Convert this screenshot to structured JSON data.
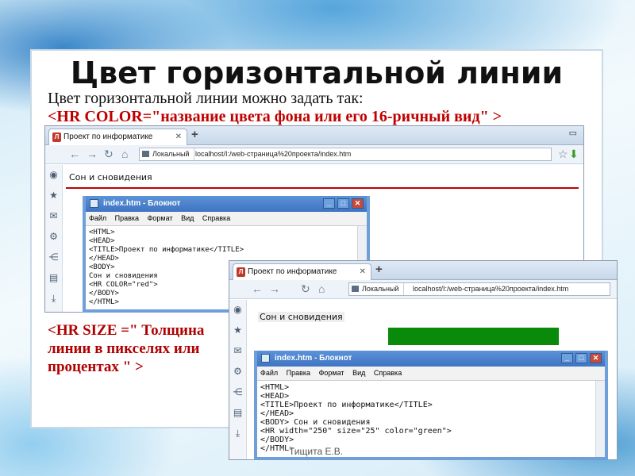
{
  "slide": {
    "title": "Цвет горизонтальной линии",
    "intro": "Цвет горизонтальной линии можно задать так:",
    "code": "<HR COLOR=\"название цвета фона или его 16-ричный вид\" >",
    "size_text": "<HR SIZE =\" Толщина линии в пикселях или процентах \" >",
    "author": "Тищита Е.В."
  },
  "browser1": {
    "tab_title": "Проект по информатике",
    "new_tab": "+",
    "local_label": "Локальный",
    "url": "localhost/I:/web-страница%20проекта/index.htm",
    "page_text": "Сон и сновидения"
  },
  "browser2": {
    "tab_title": "Проект по информатике",
    "new_tab": "+",
    "local_label": "Локальный",
    "url": "localhost/I:/web-страница%20проекта/index.htm",
    "page_text": "Сон и сновидения"
  },
  "notepad1": {
    "title": "index.htm - Блокнот",
    "menu": [
      "Файл",
      "Правка",
      "Формат",
      "Вид",
      "Справка"
    ],
    "content": "<HTML>\n<HEAD>\n<TITLE>Проект по информатике</TITLE>\n</HEAD>\n<BODY>\nСон и сновидения\n<HR COLOR=\"red\">\n</BODY>\n</HTML>"
  },
  "notepad2": {
    "title": "index.htm - Блокнот",
    "menu": [
      "Файл",
      "Правка",
      "Формат",
      "Вид",
      "Справка"
    ],
    "content": "<HTML>\n<HEAD>\n<TITLE>Проект по информатике</TITLE>\n</HEAD>\n<BODY> Сон и сновидения\n<HR width=\"250\" size=\"25\" color=\"green\">\n</BODY>\n</HTML>"
  },
  "colors": {
    "accent_red": "#c00000",
    "hr_green": "#0a8a0a",
    "hr_red": "#c00000"
  },
  "icons": [
    "back-arrow-icon",
    "forward-arrow-icon",
    "reload-icon",
    "home-icon",
    "star-icon",
    "mail-icon",
    "gear-icon",
    "download-icon"
  ]
}
